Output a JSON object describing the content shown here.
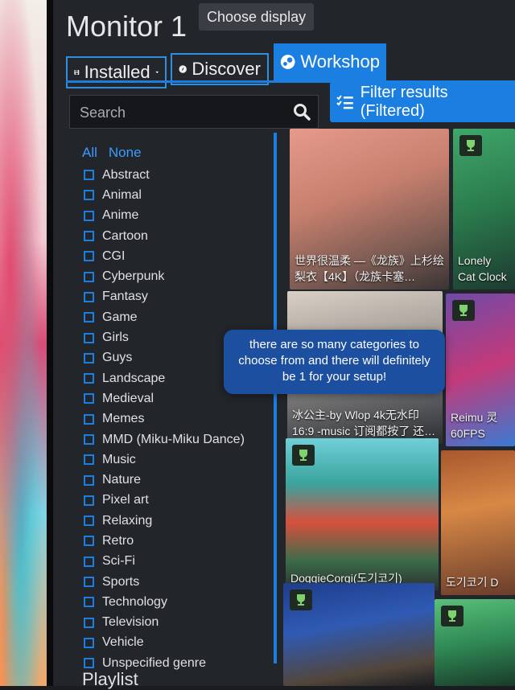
{
  "window": {
    "title": "Monitor 1",
    "choose_display_label": "Choose display"
  },
  "tabs": [
    {
      "label": "Installed",
      "icon": "save-icon",
      "has_dropdown": true
    },
    {
      "label": "Discover",
      "icon": "discover-icon"
    },
    {
      "label": "Workshop",
      "icon": "steam-icon",
      "active": true
    }
  ],
  "search": {
    "placeholder": "Search",
    "value": ""
  },
  "filter_button": {
    "label": "Filter results (Filtered)"
  },
  "categories": {
    "select_all": "All",
    "select_none": "None",
    "items": [
      "Abstract",
      "Animal",
      "Anime",
      "Cartoon",
      "CGI",
      "Cyberpunk",
      "Fantasy",
      "Game",
      "Girls",
      "Guys",
      "Landscape",
      "Medieval",
      "Memes",
      "MMD (Miku-Miku Dance)",
      "Music",
      "Nature",
      "Pixel art",
      "Relaxing",
      "Retro",
      "Sci-Fi",
      "Sports",
      "Technology",
      "Television",
      "Vehicle",
      "Unspecified genre"
    ]
  },
  "workshop_items": [
    {
      "title": "世界很温柔 —《龙族》上杉绘梨衣【4K】（龙族卡塞…",
      "has_trophy": false
    },
    {
      "title": "Lonely Cat Clock",
      "has_trophy": true
    },
    {
      "title": "冰公主-by Wlop 4k无水印 16:9 -music 订阅都按了 还…",
      "has_trophy": false
    },
    {
      "title": "Reimu 灵 60FPS",
      "has_trophy": true
    },
    {
      "title": "DoggieCorgi(도기코기)",
      "has_trophy": true
    },
    {
      "title": "도기코기 D",
      "has_trophy": false
    },
    {
      "title": "",
      "has_trophy": true
    },
    {
      "title": "",
      "has_trophy": true
    }
  ],
  "overlay_caption": "there are so many categories to choose from and there will definitely be 1 for your setup!",
  "sidebar_section": {
    "playlist_label": "Playlist"
  },
  "colors": {
    "accent": "#1a7fe0",
    "background": "#22252a",
    "link": "#3a9dff"
  }
}
